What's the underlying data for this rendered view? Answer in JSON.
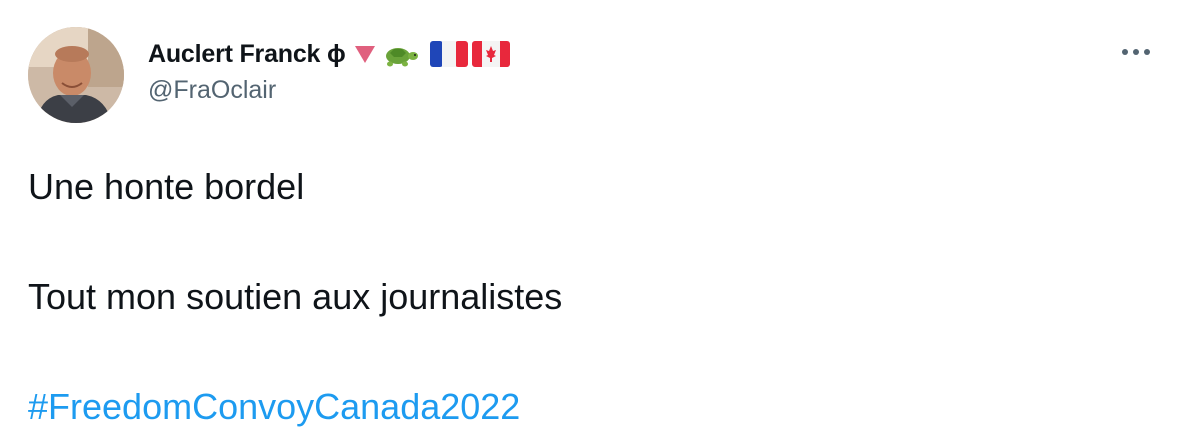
{
  "tweet": {
    "author": {
      "display_name": "Auclert Franck ϕ",
      "handle": "@FraOclair",
      "name_emojis": [
        "down-triangle-icon",
        "turtle-icon",
        "france-flag-icon",
        "canada-flag-icon"
      ]
    },
    "more_icon": "ellipsis-icon",
    "lines": [
      "Une honte bordel",
      "Tout mon soutien aux journalistes"
    ],
    "hashtag": "#FreedomConvoyCanada2022"
  },
  "colors": {
    "text": "#0f1419",
    "secondary": "#536471",
    "link": "#1d9bf0",
    "triangle": "#e0607e"
  }
}
